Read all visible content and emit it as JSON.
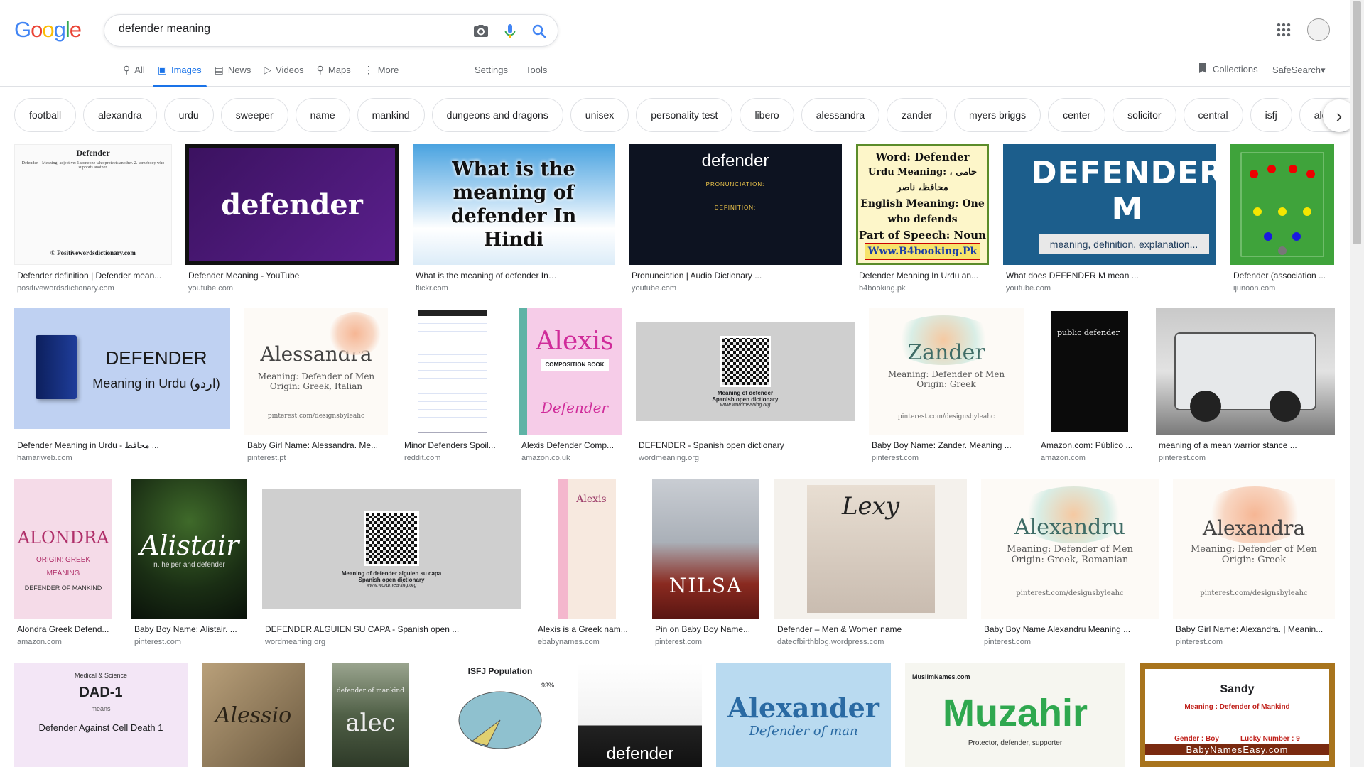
{
  "search": {
    "query": "defender meaning"
  },
  "tabs": [
    {
      "label": "All",
      "icon": "search-icon",
      "active": false
    },
    {
      "label": "Images",
      "icon": "image-icon",
      "active": true
    },
    {
      "label": "News",
      "icon": "news-icon",
      "active": false
    },
    {
      "label": "Videos",
      "icon": "video-icon",
      "active": false
    },
    {
      "label": "Maps",
      "icon": "map-icon",
      "active": false
    },
    {
      "label": "More",
      "icon": "more-dots-icon",
      "active": false
    }
  ],
  "settings_label": "Settings",
  "tools_label": "Tools",
  "collections_label": "Collections",
  "safesearch_label": "SafeSearch",
  "chips": [
    "football",
    "alexandra",
    "urdu",
    "sweeper",
    "name",
    "mankind",
    "dungeons and dragons",
    "unisex",
    "personality test",
    "libero",
    "alessandra",
    "zander",
    "myers briggs",
    "center",
    "solicitor",
    "central",
    "isfj",
    "alondra"
  ],
  "thumb_text": {
    "t0_title": "Defender",
    "t0_body": "Defender – Meaning: adjective: 1.someone who protects another. 2. somebody who supports another.",
    "t0_foot": "© Positivewordsdictionary.com",
    "t1": "defender",
    "t2": "What is the meaning of defender In Hindi",
    "t3_word": "defender",
    "t3_pron": "PRONUNCIATION:",
    "t3_def": "DEFINITION:",
    "t4_l1": "Word: Defender",
    "t4_l2": "Urdu Meaning: حامی ، محافظ، ناصر",
    "t4_l3": "English Meaning: One who defends",
    "t4_l4": "Part of Speech: Noun",
    "t4_l5": "Www.B4booking.Pk",
    "t5_title": "DEFENDER M",
    "t5_sub": "meaning, definition, explanation...",
    "t7_title": "DEFENDER",
    "t7_sub": "Meaning in Urdu (اردو)",
    "t8_name": "Alessandra",
    "t8_m1": "Meaning: Defender of Men",
    "t8_m2": "Origin: Greek, Italian",
    "t8_foot": "pinterest.com/designsbyleahc",
    "t10_name": "Alexis",
    "t10_sub": "COMPOSITION BOOK",
    "t10_foot": "Defender",
    "t11_l1": "Meaning of defender",
    "t11_l2": "Spanish open dictionary",
    "t11_l3": "www.wordmeaning.org",
    "t12_name": "Zander",
    "t12_m1": "Meaning: Defender of Men",
    "t12_m2": "Origin: Greek",
    "t12_foot": "pinterest.com/designsbyleahc",
    "t13": "public defender",
    "t15_name": "ALONDRA",
    "t15_l1": "ORIGIN: GREEK",
    "t15_l2": "MEANING",
    "t15_l3": "DEFENDER OF MANKIND",
    "t16_name": "Alistair",
    "t16_sub": "n. helper and defender",
    "t17_l1": "Meaning of defender alguien su capa",
    "t17_l2": "Spanish open dictionary",
    "t17_l3": "www.wordmeaning.org",
    "t18_name": "Alexis",
    "t19_name": "NILSA",
    "t20_name": "Lexy",
    "t21_name": "Alexandru",
    "t21_m1": "Meaning: Defender of Men",
    "t21_m2": "Origin: Greek, Romanian",
    "t21_foot": "pinterest.com/designsbyleahc",
    "t22_name": "Alexandra",
    "t22_m1": "Meaning: Defender of Men",
    "t22_m2": "Origin: Greek",
    "t22_foot": "pinterest.com/designsbyleahc",
    "t23_top": "Medical & Science",
    "t23_name": "DAD-1",
    "t23_means": "means",
    "t23_def": "Defender Against Cell Death 1",
    "t24_name": "Alessio",
    "t25_top": "defender of mankind",
    "t25_name": "alec",
    "t26_title": "ISFJ Population",
    "t26_pct": "93%",
    "t27": "defender",
    "t28_name": "Alexander",
    "t28_sub": "Defender of man",
    "t29_top": "MuslimNames.com",
    "t29_name": "Muzahir",
    "t29_sub": "Protector, defender, supporter",
    "t30_name": "Sandy",
    "t30_meaning": "Meaning : Defender of Mankind",
    "t30_gender": "Gender : Boy",
    "t30_lucky": "Lucky Number : 9",
    "t30_foot": "BabyNamesEasy.com"
  },
  "results": [
    {
      "caption": "Defender definition | Defender mean...",
      "source": "positivewordsdictionary.com"
    },
    {
      "caption": "Defender Meaning - YouTube",
      "source": "youtube.com"
    },
    {
      "caption": "What is the meaning of defender In ...",
      "source": "flickr.com"
    },
    {
      "caption": "Pronunciation | Audio Dictionary ...",
      "source": "youtube.com"
    },
    {
      "caption": "Defender Meaning In Urdu an...",
      "source": "b4booking.pk"
    },
    {
      "caption": "What does DEFENDER M mean ...",
      "source": "youtube.com"
    },
    {
      "caption": "Defender (association ...",
      "source": "ijunoon.com"
    },
    {
      "caption": "Defender Meaning in Urdu - محافظ ...",
      "source": "hamariweb.com"
    },
    {
      "caption": "Baby Girl Name: Alessandra. Me...",
      "source": "pinterest.pt"
    },
    {
      "caption": "Minor Defenders Spoil...",
      "source": "reddit.com"
    },
    {
      "caption": "Alexis Defender Comp...",
      "source": "amazon.co.uk"
    },
    {
      "caption": "DEFENDER - Spanish open dictionary",
      "source": "wordmeaning.org"
    },
    {
      "caption": "Baby Boy Name: Zander. Meaning ...",
      "source": "pinterest.com"
    },
    {
      "caption": "Amazon.com: Público ...",
      "source": "amazon.com"
    },
    {
      "caption": "meaning of a mean warrior stance ...",
      "source": "pinterest.com"
    },
    {
      "caption": "Alondra Greek Defend...",
      "source": "amazon.com"
    },
    {
      "caption": "Baby Boy Name: Alistair. ...",
      "source": "pinterest.com"
    },
    {
      "caption": "DEFENDER ALGUIEN SU CAPA - Spanish open ...",
      "source": "wordmeaning.org"
    },
    {
      "caption": "Alexis is a Greek nam...",
      "source": "ebabynames.com"
    },
    {
      "caption": "Pin on Baby Boy Name...",
      "source": "pinterest.com"
    },
    {
      "caption": "Defender – Men & Women name",
      "source": "dateofbirthblog.wordpress.com"
    },
    {
      "caption": "Baby Boy Name Alexandru Meaning ...",
      "source": "pinterest.com"
    },
    {
      "caption": "Baby Girl Name: Alexandra. | Meanin...",
      "source": "pinterest.com"
    }
  ]
}
